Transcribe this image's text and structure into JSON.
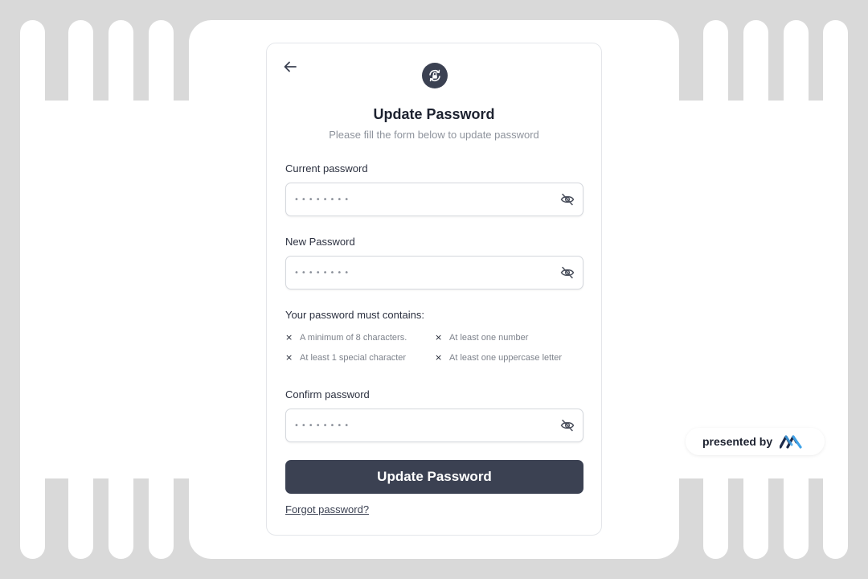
{
  "header": {
    "title": "Update Password",
    "subtitle": "Please fill the form below to update password"
  },
  "fields": {
    "current": {
      "label": "Current password",
      "value": "••••••••"
    },
    "new": {
      "label": "New Password",
      "value": "••••••••"
    },
    "confirm": {
      "label": "Confirm password",
      "value": "••••••••"
    }
  },
  "requirements": {
    "title": "Your password must contains:",
    "items": [
      "A minimum of 8 characters.",
      "At least one number",
      "At least 1 special character",
      "At least one uppercase letter"
    ],
    "status_icon": "×"
  },
  "actions": {
    "submit_label": "Update Password",
    "forgot_label": "Forgot password?"
  },
  "badge": {
    "presented_label": "presented by"
  },
  "icons": {
    "back": "arrow-left-icon",
    "lock": "lock-reset-icon",
    "visibility": "eye-off-icon",
    "brand": "brand-logo-icon"
  },
  "colors": {
    "background": "#d9d9d9",
    "primary": "#3b4152",
    "title": "#1d2230",
    "muted": "#8e939c",
    "brand_dark": "#1d2a4a",
    "brand_light": "#3fa2e8"
  }
}
